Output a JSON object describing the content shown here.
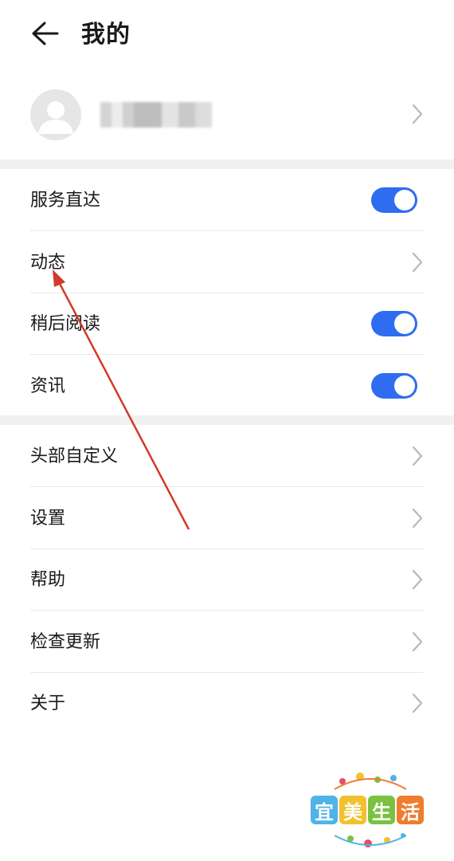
{
  "header": {
    "title": "我的",
    "back_icon": "arrow-left-icon"
  },
  "profile": {
    "username": "",
    "avatar_icon": "user-avatar-icon",
    "chevron_icon": "chevron-right-icon"
  },
  "sections": [
    {
      "items": [
        {
          "label": "服务直达",
          "control": "toggle",
          "on": true
        },
        {
          "label": "动态",
          "control": "chevron"
        },
        {
          "label": "稍后阅读",
          "control": "toggle",
          "on": true
        },
        {
          "label": "资讯",
          "control": "toggle",
          "on": true
        }
      ]
    },
    {
      "items": [
        {
          "label": "头部自定义",
          "control": "chevron"
        },
        {
          "label": "设置",
          "control": "chevron"
        },
        {
          "label": "帮助",
          "control": "chevron"
        },
        {
          "label": "检查更新",
          "control": "chevron"
        },
        {
          "label": "关于",
          "control": "chevron"
        }
      ]
    }
  ],
  "annotation": {
    "type": "red-arrow",
    "points_to": "动态",
    "color": "#d23a2a"
  },
  "watermark": {
    "chars": [
      "宜",
      "美",
      "生",
      "活"
    ],
    "colors": [
      "#4fb3e8",
      "#f2c12e",
      "#7cc242",
      "#f07c2e"
    ]
  },
  "colors": {
    "toggle_on": "#2f6df0",
    "section_band": "#f1f1f1",
    "separator": "#e8e8e8"
  }
}
